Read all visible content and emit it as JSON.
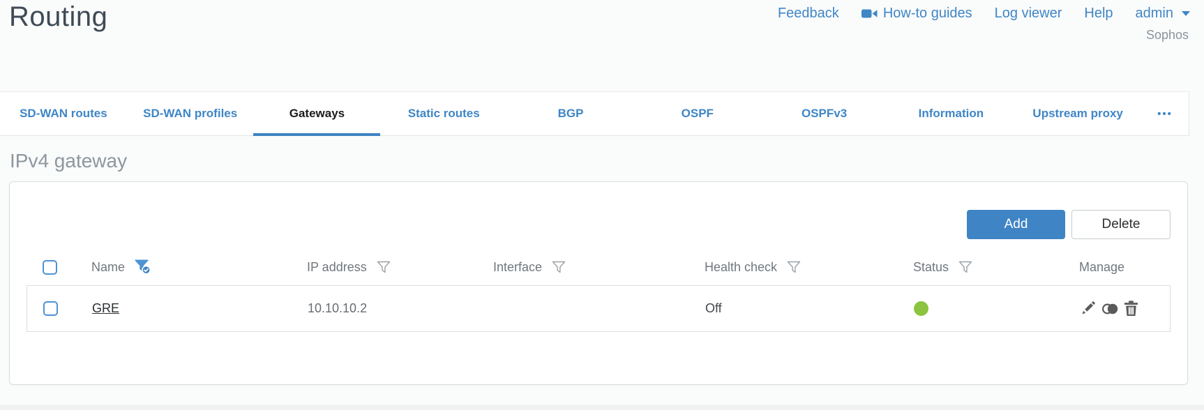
{
  "header": {
    "title": "Routing",
    "nav": {
      "feedback": "Feedback",
      "how_to_guides": "How-to guides",
      "log_viewer": "Log viewer",
      "help": "Help",
      "user": "admin"
    },
    "brand": "Sophos"
  },
  "tabs": {
    "items": [
      {
        "label": "SD-WAN routes",
        "active": false
      },
      {
        "label": "SD-WAN profiles",
        "active": false
      },
      {
        "label": "Gateways",
        "active": true
      },
      {
        "label": "Static routes",
        "active": false
      },
      {
        "label": "BGP",
        "active": false
      },
      {
        "label": "OSPF",
        "active": false
      },
      {
        "label": "OSPFv3",
        "active": false
      },
      {
        "label": "Information",
        "active": false
      },
      {
        "label": "Upstream proxy",
        "active": false
      }
    ],
    "more_label": "•••"
  },
  "section": {
    "heading": "IPv4 gateway"
  },
  "toolbar": {
    "add_label": "Add",
    "delete_label": "Delete"
  },
  "table": {
    "columns": [
      {
        "label": "Name",
        "filter": "active"
      },
      {
        "label": "IP address",
        "filter": "default"
      },
      {
        "label": "Interface",
        "filter": "default"
      },
      {
        "label": "Health check",
        "filter": "default"
      },
      {
        "label": "Status",
        "filter": "default"
      },
      {
        "label": "Manage",
        "filter": "none"
      }
    ],
    "rows": [
      {
        "name": "GRE",
        "ip_address": "10.10.10.2",
        "interface": "",
        "health_check": "Off",
        "status": "green"
      }
    ]
  },
  "icons": {
    "nav": "video-camera-icon",
    "user_menu": "caret-down-icon",
    "column_filter": "funnel-icon",
    "column_filter_active": "funnel-check-icon",
    "manage": [
      "pencil-icon",
      "clone-icon",
      "trash-icon"
    ],
    "more_tabs": "ellipsis-icon"
  },
  "colors": {
    "accent_blue": "#3f84c4",
    "status_green": "#8bc53f",
    "icon_gray": "#5a5a5a"
  }
}
